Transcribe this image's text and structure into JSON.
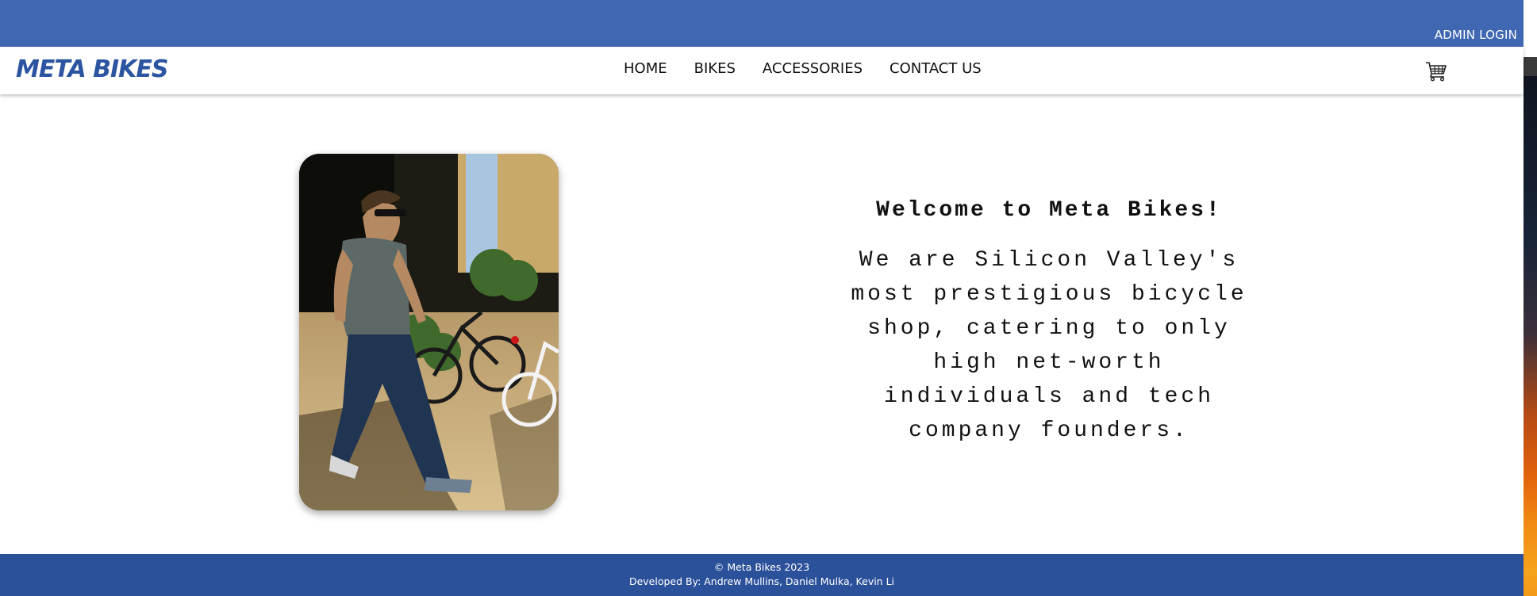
{
  "header": {
    "admin_login": "ADMIN LOGIN"
  },
  "nav": {
    "logo": "META BIKES",
    "links": [
      "HOME",
      "BIKES",
      "ACCESSORIES",
      "CONTACT US"
    ],
    "cart_icon": "shopping-cart-icon"
  },
  "hero": {
    "image_description_icon": "hero-photo",
    "title": "Welcome to Meta Bikes!",
    "body": "We are Silicon Valley's most prestigious bicycle shop, catering to only high net-worth individuals and tech company founders."
  },
  "footer": {
    "copyright": "© Meta Bikes 2023",
    "developers": "Developed By: Andrew Mullins, Daniel Mulka, Kevin Li"
  },
  "colors": {
    "topbar": "#4067b2",
    "logo": "#2b54a1",
    "footer": "#2c519b"
  }
}
